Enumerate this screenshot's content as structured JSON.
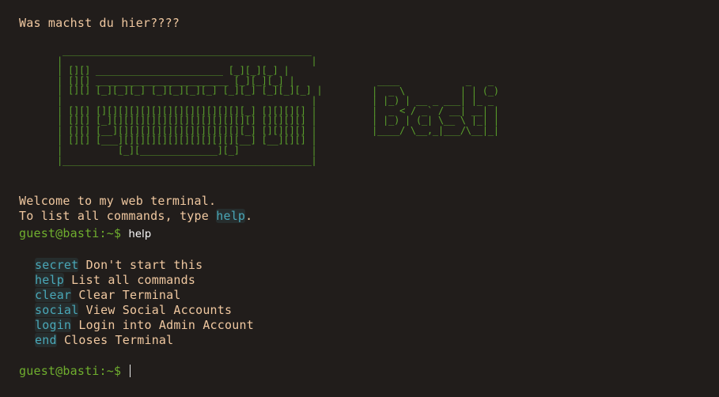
{
  "header_line": "Was machst du hier????",
  "ascii_art_frame": " _____________________________________________\n|                                             |\n| [][] _______________________ [_][_][_] |\n| [][] ________________________ [_][_][_] |\n| [][] [_][_][_] [_][_][_][_] [_][_] [_][_][_] |\n|                                             |\n| [][] [][][][][][][][][][][][][][_] [][][][] |\n| [][] [_][][][][][][][][][][][][][] [][][][] |\n| [][] [__][][][][][][][][][][][][_] [][][][] |\n| [][] [___][][][][][][][][][][][__] [__][][] |\n|          [_][______________][_]             |\n|_____________________________________________|",
  "ascii_art_logo": " ____            _   _ \n|  _ \\          | | (_)\n| |_) | __ _ ___| |_ _ \n|  _ < / _` / __| __| |\n| |_) | (_| \\__ \\ |_| |\n|____/ \\__,_|___/\\__|_|",
  "welcome_line": "Welcome to my web terminal.",
  "list_line_prefix": "To list all commands, type ",
  "list_line_cmd": "help",
  "list_line_suffix": ".",
  "prompt": "guest@basti:~$",
  "typed_command": "help",
  "commands": [
    {
      "name": "secret",
      "desc": "Don't start this"
    },
    {
      "name": "help",
      "desc": "List all commands"
    },
    {
      "name": "clear",
      "desc": "Clear Terminal"
    },
    {
      "name": "social",
      "desc": "View Social Accounts"
    },
    {
      "name": "login",
      "desc": "Login into Admin Account"
    },
    {
      "name": "end",
      "desc": "Closes Terminal"
    }
  ],
  "colors": {
    "background": "#211d1b",
    "text": "#f0c8a0",
    "prompt": "#6fae2e",
    "command": "#4aa8b8",
    "ascii": "#5aa02c"
  }
}
